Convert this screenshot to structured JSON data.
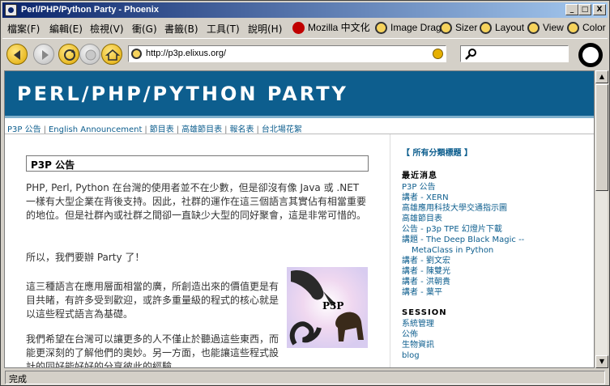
{
  "window": {
    "title": "Perl/PHP/Python Party - Phoenix",
    "controls": {
      "minimize": "_",
      "maximize": "□",
      "close": "X"
    }
  },
  "menubar": {
    "menus": [
      "檔案(F)",
      "編輯(E)",
      "檢視(V)",
      "衝(G)",
      "書籤(B)",
      "工具(T)",
      "說明(H)"
    ],
    "buttons": [
      {
        "label": "Mozilla 中文化",
        "icon": "mozilla-lizard-icon"
      },
      {
        "label": "Image Drag",
        "icon": "image-drag-icon"
      },
      {
        "label": "Sizer",
        "icon": "sizer-icon"
      },
      {
        "label": "Layout",
        "icon": "layout-icon"
      },
      {
        "label": "View",
        "icon": "view-icon"
      },
      {
        "label": "Color",
        "icon": "color-icon"
      }
    ]
  },
  "navbar": {
    "url": "http://p3p.elixus.org/",
    "search_value": ""
  },
  "site": {
    "title": "PERL/PHP/PYTHON PARTY",
    "topnav": [
      "P3P 公告",
      "English Announcement",
      "節目表",
      "高雄節目表",
      "報名表",
      "台北場花絮"
    ]
  },
  "main": {
    "heading": "P3P 公告",
    "paragraphs": [
      "PHP, Perl, Python 在台灣的使用者並不在少數，但是卻沒有像 Java 或 .NET 一樣有大型企業在背後支持。因此，社群的運作在這三個語言其實佔有相當重要的地位。但是社群內或社群之間卻一直缺少大型的同好聚會，這是非常可惜的。",
      "所以，我們要辦 Party 了！",
      "這三種語言在應用層面相當的廣，所創造出來的價值更是有目共睹，有許多受到歡迎，或許多重量級的程式的核心就是以這些程式語言為基礎。",
      "我們希望在台灣可以讓更多的人不僅止於聽過這些東西，而能更深刻的了解他們的奧妙。另一方面，也能讓這些程式設計的同好能好好的分享彼此的經驗。"
    ],
    "logo_text": "P3P"
  },
  "sidebar": {
    "all_categories": "【 所有分類標題 】",
    "latest_heading": "最近消息",
    "latest": [
      "P3P 公告",
      "講者 - XERN",
      "高雄應用科技大學交通指示圖",
      "高雄節目表",
      "公告 - p3p TPE 幻燈片下載",
      "講題 - The Deep Black Magic --",
      "MetaClass in Python",
      "講者 - 劉文宏",
      "講者 - 陳雙光",
      "講者 - 洪朝貴",
      "講者 - 葉平"
    ],
    "session_heading": "SESSION",
    "session": [
      "系統管理",
      "公佈",
      "生物資訊",
      "blog"
    ]
  },
  "status": {
    "text": "完成"
  },
  "colors": {
    "banner": "#0d5e8e",
    "link": "#0d5e8e",
    "titlebar_start": "#0a246a",
    "titlebar_end": "#a6caf0"
  }
}
